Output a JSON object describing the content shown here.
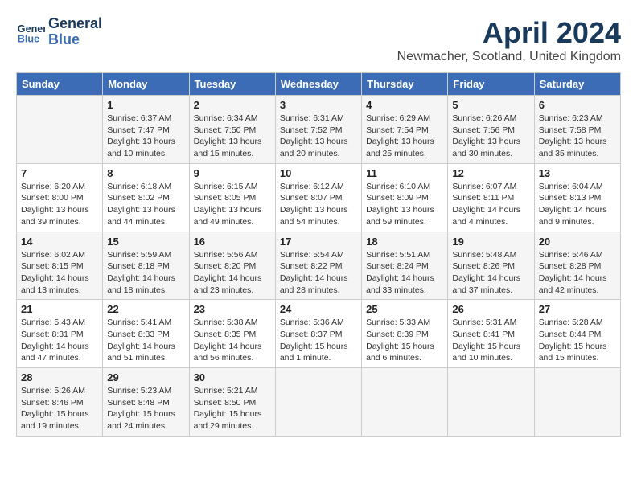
{
  "header": {
    "logo_line1": "General",
    "logo_line2": "Blue",
    "month": "April 2024",
    "location": "Newmacher, Scotland, United Kingdom"
  },
  "days_of_week": [
    "Sunday",
    "Monday",
    "Tuesday",
    "Wednesday",
    "Thursday",
    "Friday",
    "Saturday"
  ],
  "weeks": [
    [
      {
        "day": "",
        "info": ""
      },
      {
        "day": "1",
        "info": "Sunrise: 6:37 AM\nSunset: 7:47 PM\nDaylight: 13 hours\nand 10 minutes."
      },
      {
        "day": "2",
        "info": "Sunrise: 6:34 AM\nSunset: 7:50 PM\nDaylight: 13 hours\nand 15 minutes."
      },
      {
        "day": "3",
        "info": "Sunrise: 6:31 AM\nSunset: 7:52 PM\nDaylight: 13 hours\nand 20 minutes."
      },
      {
        "day": "4",
        "info": "Sunrise: 6:29 AM\nSunset: 7:54 PM\nDaylight: 13 hours\nand 25 minutes."
      },
      {
        "day": "5",
        "info": "Sunrise: 6:26 AM\nSunset: 7:56 PM\nDaylight: 13 hours\nand 30 minutes."
      },
      {
        "day": "6",
        "info": "Sunrise: 6:23 AM\nSunset: 7:58 PM\nDaylight: 13 hours\nand 35 minutes."
      }
    ],
    [
      {
        "day": "7",
        "info": "Sunrise: 6:20 AM\nSunset: 8:00 PM\nDaylight: 13 hours\nand 39 minutes."
      },
      {
        "day": "8",
        "info": "Sunrise: 6:18 AM\nSunset: 8:02 PM\nDaylight: 13 hours\nand 44 minutes."
      },
      {
        "day": "9",
        "info": "Sunrise: 6:15 AM\nSunset: 8:05 PM\nDaylight: 13 hours\nand 49 minutes."
      },
      {
        "day": "10",
        "info": "Sunrise: 6:12 AM\nSunset: 8:07 PM\nDaylight: 13 hours\nand 54 minutes."
      },
      {
        "day": "11",
        "info": "Sunrise: 6:10 AM\nSunset: 8:09 PM\nDaylight: 13 hours\nand 59 minutes."
      },
      {
        "day": "12",
        "info": "Sunrise: 6:07 AM\nSunset: 8:11 PM\nDaylight: 14 hours\nand 4 minutes."
      },
      {
        "day": "13",
        "info": "Sunrise: 6:04 AM\nSunset: 8:13 PM\nDaylight: 14 hours\nand 9 minutes."
      }
    ],
    [
      {
        "day": "14",
        "info": "Sunrise: 6:02 AM\nSunset: 8:15 PM\nDaylight: 14 hours\nand 13 minutes."
      },
      {
        "day": "15",
        "info": "Sunrise: 5:59 AM\nSunset: 8:18 PM\nDaylight: 14 hours\nand 18 minutes."
      },
      {
        "day": "16",
        "info": "Sunrise: 5:56 AM\nSunset: 8:20 PM\nDaylight: 14 hours\nand 23 minutes."
      },
      {
        "day": "17",
        "info": "Sunrise: 5:54 AM\nSunset: 8:22 PM\nDaylight: 14 hours\nand 28 minutes."
      },
      {
        "day": "18",
        "info": "Sunrise: 5:51 AM\nSunset: 8:24 PM\nDaylight: 14 hours\nand 33 minutes."
      },
      {
        "day": "19",
        "info": "Sunrise: 5:48 AM\nSunset: 8:26 PM\nDaylight: 14 hours\nand 37 minutes."
      },
      {
        "day": "20",
        "info": "Sunrise: 5:46 AM\nSunset: 8:28 PM\nDaylight: 14 hours\nand 42 minutes."
      }
    ],
    [
      {
        "day": "21",
        "info": "Sunrise: 5:43 AM\nSunset: 8:31 PM\nDaylight: 14 hours\nand 47 minutes."
      },
      {
        "day": "22",
        "info": "Sunrise: 5:41 AM\nSunset: 8:33 PM\nDaylight: 14 hours\nand 51 minutes."
      },
      {
        "day": "23",
        "info": "Sunrise: 5:38 AM\nSunset: 8:35 PM\nDaylight: 14 hours\nand 56 minutes."
      },
      {
        "day": "24",
        "info": "Sunrise: 5:36 AM\nSunset: 8:37 PM\nDaylight: 15 hours\nand 1 minute."
      },
      {
        "day": "25",
        "info": "Sunrise: 5:33 AM\nSunset: 8:39 PM\nDaylight: 15 hours\nand 6 minutes."
      },
      {
        "day": "26",
        "info": "Sunrise: 5:31 AM\nSunset: 8:41 PM\nDaylight: 15 hours\nand 10 minutes."
      },
      {
        "day": "27",
        "info": "Sunrise: 5:28 AM\nSunset: 8:44 PM\nDaylight: 15 hours\nand 15 minutes."
      }
    ],
    [
      {
        "day": "28",
        "info": "Sunrise: 5:26 AM\nSunset: 8:46 PM\nDaylight: 15 hours\nand 19 minutes."
      },
      {
        "day": "29",
        "info": "Sunrise: 5:23 AM\nSunset: 8:48 PM\nDaylight: 15 hours\nand 24 minutes."
      },
      {
        "day": "30",
        "info": "Sunrise: 5:21 AM\nSunset: 8:50 PM\nDaylight: 15 hours\nand 29 minutes."
      },
      {
        "day": "",
        "info": ""
      },
      {
        "day": "",
        "info": ""
      },
      {
        "day": "",
        "info": ""
      },
      {
        "day": "",
        "info": ""
      }
    ]
  ]
}
